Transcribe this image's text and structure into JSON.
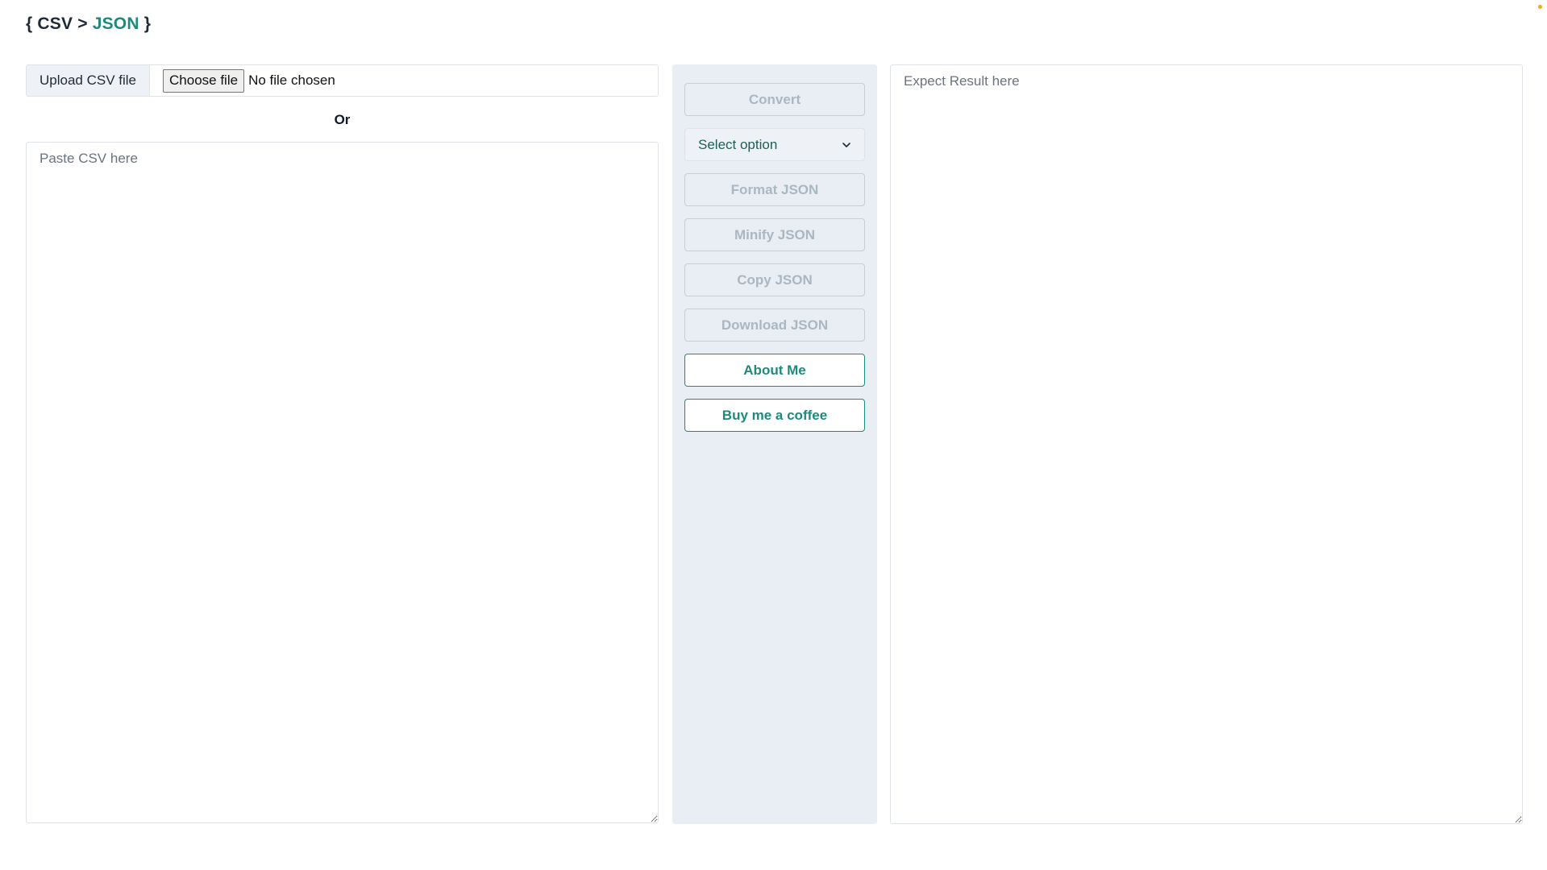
{
  "header": {
    "title_prefix": "{ CSV > ",
    "title_accent": "JSON",
    "title_suffix": " }"
  },
  "upload": {
    "label": "Upload CSV file",
    "choose_button": "Choose file",
    "file_status": "No file chosen"
  },
  "or_label": "Or",
  "csv_input": {
    "placeholder": "Paste CSV here",
    "value": ""
  },
  "controls": {
    "convert": "Convert",
    "select": {
      "selected": "Select option"
    },
    "format": "Format JSON",
    "minify": "Minify JSON",
    "copy": "Copy JSON",
    "download": "Download JSON",
    "about": "About Me",
    "coffee": "Buy me a coffee"
  },
  "result": {
    "placeholder": "Expect Result here",
    "value": ""
  },
  "colors": {
    "accent": "#1e8a7c",
    "panel_bg": "#e9eef4",
    "disabled_text": "#a9b7c3",
    "corner_dot": "#f5a623"
  }
}
